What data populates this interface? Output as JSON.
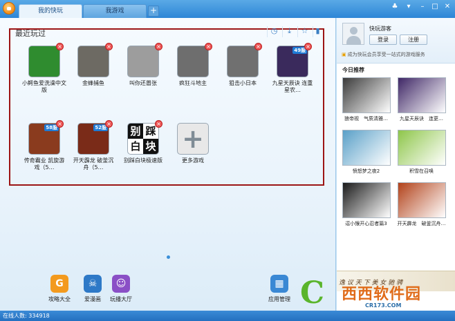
{
  "tabs": [
    {
      "label": "我的快玩"
    },
    {
      "label": "我游戏"
    }
  ],
  "recent": {
    "title": "最近玩过",
    "games": [
      {
        "label": "小鳄鱼爱洗澡中文版",
        "color": "#2f8c2f"
      },
      {
        "label": "金蜂捕鱼",
        "color": "#6d6a63"
      },
      {
        "label": "叫你还嚣张",
        "color": "#9d9d9d"
      },
      {
        "label": "疯狂斗地主",
        "color": "#6e6e6e"
      },
      {
        "label": "狙击小日本",
        "color": "#707070"
      },
      {
        "label": "九星天辰诀 连重星农…",
        "badge": "49服",
        "color": "#3a2a5c"
      },
      {
        "label": "传奇霸业 凯旋游戏（5…",
        "badge": "58服",
        "color": "#8a3b1e"
      },
      {
        "label": "开天霹龙 破釜沉舟（5…",
        "badge": "52服",
        "color": "#7a2b18"
      },
      {
        "label": "别踩白块极速版",
        "color": "#ffffff",
        "tile": [
          "别",
          "踩",
          "白",
          "块"
        ]
      },
      {
        "label": "更多游戏",
        "color": "#e8e8e8",
        "plus": "+"
      }
    ]
  },
  "dock": [
    {
      "label": "攻略大全",
      "glyph": "G",
      "color": "#f39a1e"
    },
    {
      "label": "爱漫画",
      "glyph": "☠",
      "color": "#2e79c7"
    },
    {
      "label": "玩播大厅",
      "glyph": "☺",
      "color": "#8a4fc6"
    },
    {
      "label": "应用管理",
      "glyph": "▦",
      "color": "#3a88d4"
    }
  ],
  "status": {
    "online": "在线人数: 334918"
  },
  "sidebar": {
    "guest_name": "快玩游客",
    "login_label": "登录",
    "register_label": "注册",
    "member_text": "成为快玩会员享受一站式的游戏服务",
    "today_title": "今日推荐",
    "recommendations": [
      {
        "label": "狼帝视　气质清雅…",
        "color": "#3b3b3b"
      },
      {
        "label": "九星天辰诀　连更…",
        "color": "#3f2766"
      },
      {
        "label": "愤怒梦之夜2",
        "color": "#5aa0c8"
      },
      {
        "label": "积雪在召唤",
        "color": "#8ec64a"
      },
      {
        "label": "逗小猴开心忍者篇3",
        "color": "#1a1a1a"
      },
      {
        "label": "开天霹龙　破釜沉舟…",
        "color": "#b2421a"
      }
    ],
    "banner_text": "逸 议 天 下 美 女 驰 骋"
  },
  "watermark": {
    "brand": "西西软件园",
    "site": "CR173.COM",
    "mark": "C"
  }
}
